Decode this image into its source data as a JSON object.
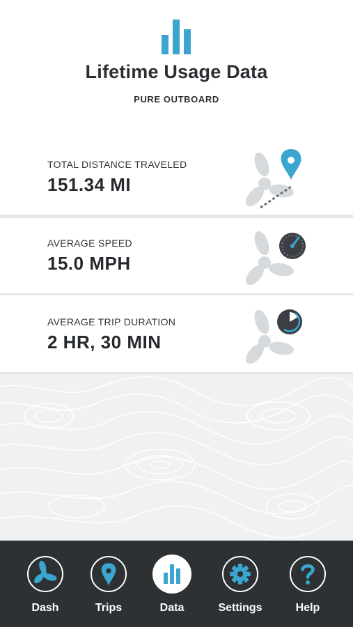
{
  "header": {
    "icon": "bar-chart-icon",
    "title": "Lifetime Usage Data",
    "subtitle": "PURE OUTBOARD"
  },
  "stats": [
    {
      "label": "TOTAL DISTANCE TRAVELED",
      "value": "151.34 MI",
      "icon": "propeller-route-pin-icon"
    },
    {
      "label": "AVERAGE SPEED",
      "value": "15.0 MPH",
      "icon": "propeller-speedometer-icon"
    },
    {
      "label": "AVERAGE TRIP DURATION",
      "value": "2 HR, 30 MIN",
      "icon": "propeller-clock-icon"
    }
  ],
  "nav": {
    "items": [
      {
        "label": "Dash",
        "icon": "propeller-icon"
      },
      {
        "label": "Trips",
        "icon": "map-pin-icon"
      },
      {
        "label": "Data",
        "icon": "bar-chart-icon",
        "active": true
      },
      {
        "label": "Settings",
        "icon": "gear-icon"
      },
      {
        "label": "Help",
        "icon": "question-mark-icon"
      }
    ]
  },
  "colors": {
    "accent": "#3aa6cf",
    "nav_background": "#2e3134",
    "text": "#2b2f33",
    "divider": "#e4e6e8",
    "propeller_gray": "#d6dadd",
    "topo_background": "#f0f1f3"
  }
}
